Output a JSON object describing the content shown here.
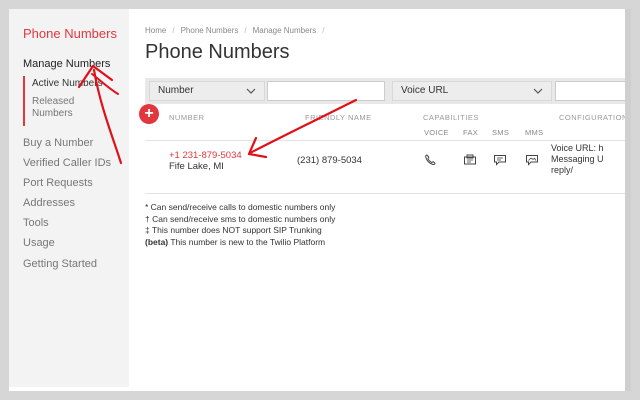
{
  "sidebar": {
    "brand": "Phone Numbers",
    "manage_label": "Manage Numbers",
    "active_label": "Active Numbers",
    "released_label_1": "Released",
    "released_label_2": "Numbers",
    "items": [
      {
        "label": "Buy a Number"
      },
      {
        "label": "Verified Caller IDs"
      },
      {
        "label": "Port Requests"
      },
      {
        "label": "Addresses"
      },
      {
        "label": "Tools"
      },
      {
        "label": "Usage"
      },
      {
        "label": "Getting Started"
      }
    ]
  },
  "breadcrumb": [
    "Home",
    "Phone Numbers",
    "Manage Numbers"
  ],
  "page_title": "Phone Numbers",
  "filters": {
    "field_select": "Number",
    "url_select": "Voice URL"
  },
  "add_button": "+",
  "table": {
    "col_number": "NUMBER",
    "col_friendly": "FRIENDLY NAME",
    "col_capabilities": "CAPABILITIES",
    "col_config": "CONFIGURATION",
    "cap_voice": "VOICE",
    "cap_fax": "FAX",
    "cap_sms": "SMS",
    "cap_mms": "MMS",
    "rows": [
      {
        "number": "+1 231-879-5034",
        "location": "Fife Lake, MI",
        "friendly": "(231) 879-5034",
        "config_line1": "Voice URL: h",
        "config_line2": "Messaging U",
        "config_line3": "reply/"
      }
    ]
  },
  "legend": {
    "line1": "* Can send/receive calls to domestic numbers only",
    "line2": "† Can send/receive sms to domestic numbers only",
    "line3": "‡ This number does NOT support SIP Trunking",
    "beta_tag": "(beta)",
    "beta_text": " This number is new to the Twilio Platform"
  },
  "icons": {
    "voice": "phone-icon",
    "fax": "fax-icon",
    "sms": "chat-bubble-icon",
    "mms": "picture-message-icon",
    "chevron": "chevron-down-icon"
  },
  "colors": {
    "accent": "#e0383e",
    "sidebar_bg": "#f3f3f3",
    "filter_bg": "#e8e8e8"
  }
}
